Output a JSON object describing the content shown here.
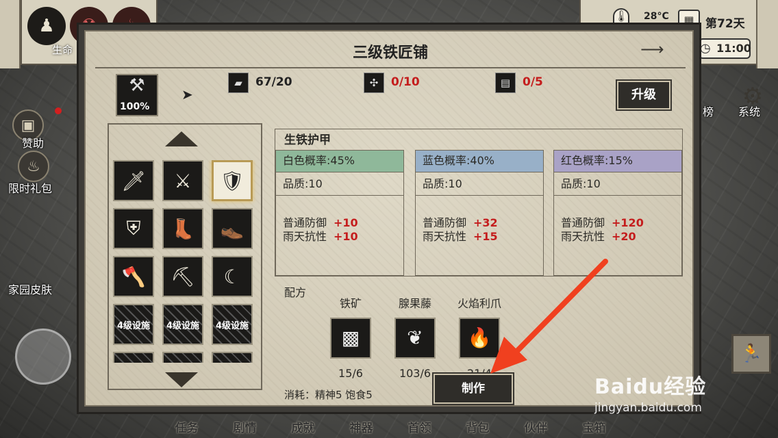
{
  "hud": {
    "life_label": "生命",
    "temperature": "28°C",
    "day": "第72天",
    "time": "11:00"
  },
  "side": {
    "sponsor": "赞助",
    "limited_gift": "限时礼包",
    "home_skin": "家园皮肤",
    "rank_partial": "榜",
    "system": "系统"
  },
  "nav": [
    "任务",
    "剧情",
    "成就",
    "神器",
    "首领",
    "背包",
    "伙伴",
    "宝箱"
  ],
  "watermark": {
    "brand": "Baidu经验",
    "url": "jingyan.baidu.com"
  },
  "dialog": {
    "title": "三级铁匠铺",
    "facility_pct": "100%",
    "resources": [
      {
        "icon": "iron-ingot-icon",
        "value": "67/20",
        "color": "#222222"
      },
      {
        "icon": "herb-icon",
        "value": "0/10",
        "color": "#c41d1d"
      },
      {
        "icon": "stone-icon",
        "value": "0/5",
        "color": "#c41d1d"
      }
    ],
    "upgrade_label": "升级",
    "locked_label": "4级设施",
    "item_name": "生铁护甲",
    "tiers": [
      {
        "chance": "白色概率:45%",
        "color": "#8fb89a",
        "quality": "品质:10",
        "def_label": "普通防御",
        "def": "+10",
        "rain_label": "雨天抗性",
        "rain": "+10"
      },
      {
        "chance": "蓝色概率:40%",
        "color": "#98b0c8",
        "quality": "品质:10",
        "def_label": "普通防御",
        "def": "+32",
        "rain_label": "雨天抗性",
        "rain": "+15"
      },
      {
        "chance": "红色概率:15%",
        "color": "#a9a2c6",
        "quality": "品质:10",
        "def_label": "普通防御",
        "def": "+120",
        "rain_label": "雨天抗性",
        "rain": "+20"
      }
    ],
    "recipe_label": "配方",
    "materials": [
      {
        "name": "铁矿",
        "count": "15/6"
      },
      {
        "name": "腺果藤",
        "count": "103/6"
      },
      {
        "name": "火焰利爪",
        "count": "21/4"
      }
    ],
    "cost": "消耗：精神5   饱食5",
    "make_label": "制作"
  }
}
